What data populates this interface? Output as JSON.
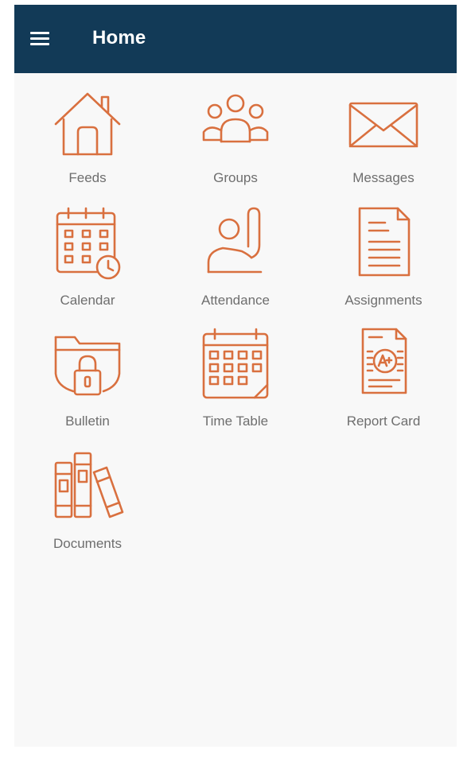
{
  "appbar": {
    "title": "Home",
    "menu_icon": "hamburger-menu-icon",
    "background_color": "#123a57"
  },
  "theme": {
    "icon_color": "#d9703f",
    "label_color": "#6e6e6e",
    "screen_background": "#f8f8f8"
  },
  "tiles": [
    {
      "label": "Feeds",
      "icon": "house-icon"
    },
    {
      "label": "Groups",
      "icon": "people-group-icon"
    },
    {
      "label": "Messages",
      "icon": "envelope-icon"
    },
    {
      "label": "Calendar",
      "icon": "calendar-clock-icon"
    },
    {
      "label": "Attendance",
      "icon": "raised-hand-icon"
    },
    {
      "label": "Assignments",
      "icon": "document-icon"
    },
    {
      "label": "Bulletin",
      "icon": "locked-folder-icon"
    },
    {
      "label": "Time Table",
      "icon": "calendar-grid-icon"
    },
    {
      "label": "Report Card",
      "icon": "report-card-icon"
    },
    {
      "label": "Documents",
      "icon": "books-icon"
    }
  ]
}
